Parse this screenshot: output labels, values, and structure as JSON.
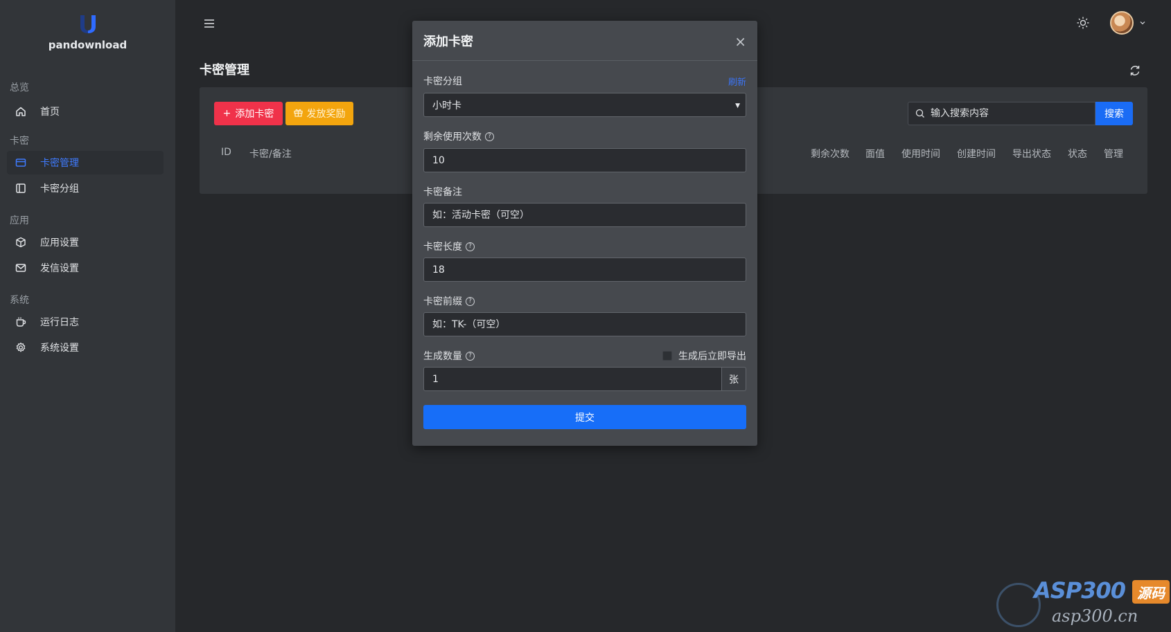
{
  "brand": {
    "name": "pandownload"
  },
  "sidebar": {
    "sections": [
      {
        "title": "总览",
        "items": [
          {
            "label": "首页",
            "icon": "home-icon"
          }
        ]
      },
      {
        "title": "卡密",
        "items": [
          {
            "label": "卡密管理",
            "icon": "card-icon",
            "active": true
          },
          {
            "label": "卡密分组",
            "icon": "group-icon"
          }
        ]
      },
      {
        "title": "应用",
        "items": [
          {
            "label": "应用设置",
            "icon": "box-icon"
          },
          {
            "label": "发信设置",
            "icon": "mail-icon"
          }
        ]
      },
      {
        "title": "系统",
        "items": [
          {
            "label": "运行日志",
            "icon": "log-icon"
          },
          {
            "label": "系统设置",
            "icon": "gear-icon"
          }
        ]
      }
    ]
  },
  "page": {
    "title": "卡密管理"
  },
  "toolbar": {
    "add_label": "添加卡密",
    "reward_label": "发放奖励",
    "search_placeholder": "输入搜索内容",
    "search_label": "搜索"
  },
  "table": {
    "columns": [
      "ID",
      "卡密/备注",
      "剩余次数",
      "面值",
      "使用时间",
      "创建时间",
      "导出状态",
      "状态",
      "管理"
    ]
  },
  "modal": {
    "title": "添加卡密",
    "close": "×",
    "group_label": "卡密分组",
    "group_refresh": "刷新",
    "group_value": "小时卡",
    "uses_label": "剩余使用次数",
    "uses_value": "10",
    "note_label": "卡密备注",
    "note_placeholder": "如：活动卡密（可空）",
    "length_label": "卡密长度",
    "length_value": "18",
    "prefix_label": "卡密前缀",
    "prefix_placeholder": "如：TK-（可空）",
    "count_label": "生成数量",
    "export_label": "生成后立即导出",
    "count_value": "1",
    "count_unit": "张",
    "submit_label": "提交"
  },
  "watermark": {
    "top": "ASP300",
    "badge": "源码",
    "bottom": "asp300.cn"
  },
  "colors": {
    "accent": "#1a6cf5",
    "danger": "#f0324a",
    "warning": "#f3a50e",
    "sidebar": "#323539",
    "background": "#26282b"
  }
}
